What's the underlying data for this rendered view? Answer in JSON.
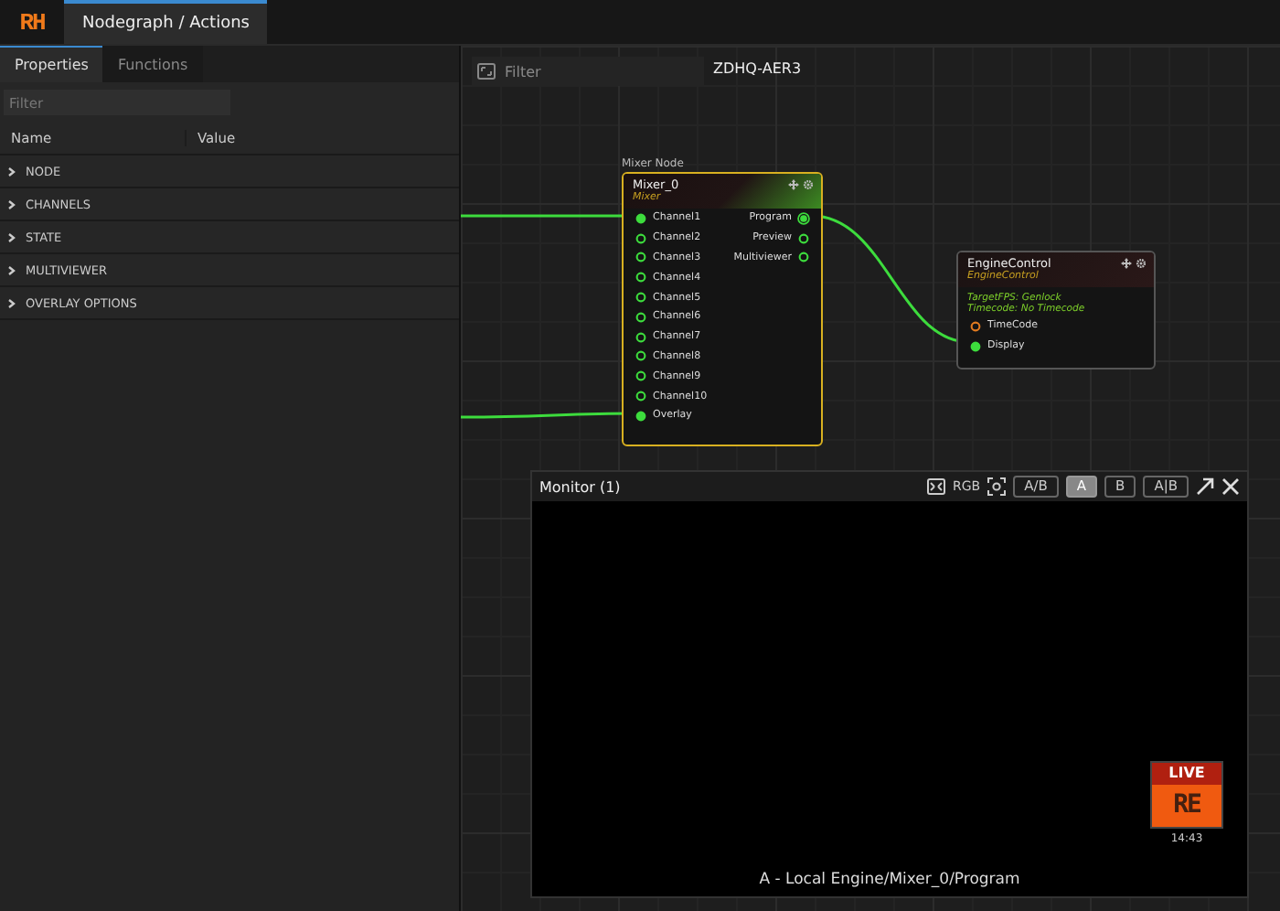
{
  "app": {
    "logo": "RH"
  },
  "tabs": [
    {
      "label": "Nodegraph / Actions",
      "selected": true
    }
  ],
  "panel": {
    "tabs": [
      {
        "label": "Properties",
        "selected": true
      },
      {
        "label": "Functions",
        "selected": false
      }
    ],
    "filter": {
      "placeholder": "Filter"
    },
    "columns": [
      "Name",
      "Value"
    ],
    "groups": [
      {
        "label": "NODE",
        "expanded": false
      },
      {
        "label": "CHANNELS",
        "expanded": false
      },
      {
        "label": "STATE",
        "expanded": false
      },
      {
        "label": "MULTIVIEWER",
        "expanded": false
      },
      {
        "label": "OVERLAY OPTIONS",
        "expanded": false
      }
    ]
  },
  "canvas": {
    "filter": {
      "placeholder": "Filter"
    },
    "engine_name": "ZDHQ-AER3",
    "nodes": [
      {
        "caption": "Mixer Node",
        "title": "Mixer_0",
        "type": "Mixer",
        "selected": true,
        "inputs": [
          {
            "name": "Channel1",
            "connected": true,
            "color": "#3ddc3d"
          },
          {
            "name": "Channel2",
            "connected": false,
            "color": "#3ddc3d"
          },
          {
            "name": "Channel3",
            "connected": false,
            "color": "#3ddc3d"
          },
          {
            "name": "Channel4",
            "connected": false,
            "color": "#3ddc3d"
          },
          {
            "name": "Channel5",
            "connected": false,
            "color": "#3ddc3d"
          },
          {
            "name": "Channel6",
            "connected": false,
            "color": "#3ddc3d"
          },
          {
            "name": "Channel7",
            "connected": false,
            "color": "#3ddc3d"
          },
          {
            "name": "Channel8",
            "connected": false,
            "color": "#3ddc3d"
          },
          {
            "name": "Channel9",
            "connected": false,
            "color": "#3ddc3d"
          },
          {
            "name": "Channel10",
            "connected": false,
            "color": "#3ddc3d"
          },
          {
            "name": "Overlay",
            "connected": true,
            "color": "#3ddc3d"
          }
        ],
        "outputs": [
          {
            "name": "Program",
            "connected": true,
            "color": "#3ddc3d"
          },
          {
            "name": "Preview",
            "connected": false,
            "color": "#3ddc3d"
          },
          {
            "name": "Multiviewer",
            "connected": false,
            "color": "#3ddc3d"
          }
        ]
      },
      {
        "title": "EngineControl",
        "type": "EngineControl",
        "selected": false,
        "info": [
          "TargetFPS: Genlock",
          "Timecode: No Timecode"
        ],
        "inputs": [
          {
            "name": "TimeCode",
            "connected": false,
            "color": "#e07a20"
          },
          {
            "name": "Display",
            "connected": true,
            "color": "#3ddc3d"
          }
        ]
      }
    ],
    "monitor": {
      "title": "Monitor (1)",
      "rgb_label": "RGB",
      "modes": [
        {
          "label": "A/B",
          "selected": false
        },
        {
          "label": "A",
          "selected": true
        },
        {
          "label": "B",
          "selected": false
        },
        {
          "label": "A|B",
          "selected": false
        }
      ],
      "live": {
        "label": "LIVE",
        "logo": "RE",
        "time": "14:43"
      },
      "source": "A - Local Engine/Mixer_0/Program"
    }
  }
}
